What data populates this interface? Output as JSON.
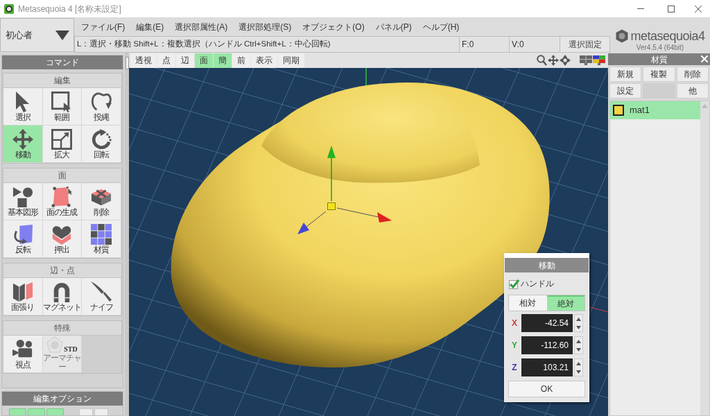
{
  "window": {
    "title": "Metasequoia 4 [名称未設定]"
  },
  "mode_dropdown": {
    "value": "初心者"
  },
  "menu": [
    "ファイル(F)",
    "編集(E)",
    "選択部属性(A)",
    "選択部処理(S)",
    "オブジェクト(O)",
    "パネル(P)",
    "ヘルプ(H)"
  ],
  "status_bar": {
    "hint": "L：選択・移動 Shift+L：複数選択（ハンドル Ctrl+Shift+L：中心回転)",
    "faces": "F:0",
    "vertices": "V:0",
    "lock_button": "選択固定"
  },
  "logo": {
    "wordmark": "metasequoia4",
    "version": "Ver4.5.4 (64bit)"
  },
  "command_panel": {
    "title": "コマンド",
    "sections": [
      {
        "title": "編集",
        "tools": [
          {
            "label": "選択",
            "kind": "select",
            "selected": false,
            "disabled": false
          },
          {
            "label": "範囲",
            "kind": "range",
            "selected": false,
            "disabled": false
          },
          {
            "label": "投縄",
            "kind": "lasso",
            "selected": false,
            "disabled": false
          },
          {
            "label": "移動",
            "kind": "move",
            "selected": true,
            "disabled": false
          },
          {
            "label": "拡大",
            "kind": "scale",
            "selected": false,
            "disabled": false
          },
          {
            "label": "回転",
            "kind": "rotate",
            "selected": false,
            "disabled": false
          }
        ]
      },
      {
        "title": "面",
        "tools": [
          {
            "label": "基本図形",
            "kind": "primitive",
            "selected": false,
            "disabled": false
          },
          {
            "label": "面の生成",
            "kind": "face",
            "selected": false,
            "disabled": false
          },
          {
            "label": "削除",
            "kind": "delete",
            "selected": false,
            "disabled": false
          },
          {
            "label": "反転",
            "kind": "flip",
            "selected": false,
            "disabled": false
          },
          {
            "label": "押出",
            "kind": "extrude",
            "selected": false,
            "disabled": false
          },
          {
            "label": "材質",
            "kind": "material",
            "selected": false,
            "disabled": false
          }
        ]
      },
      {
        "title": "辺・点",
        "tools": [
          {
            "label": "面張り",
            "kind": "bridge",
            "selected": false,
            "disabled": false
          },
          {
            "label": "マグネット",
            "kind": "magnet",
            "selected": false,
            "disabled": false
          },
          {
            "label": "ナイフ",
            "kind": "knife",
            "selected": false,
            "disabled": false
          }
        ]
      },
      {
        "title": "特殊",
        "tools": [
          {
            "label": "視点",
            "kind": "viewpoint",
            "selected": false,
            "disabled": false
          },
          {
            "label": "アーマチャー",
            "kind": "armature",
            "badge": "STD",
            "selected": false,
            "disabled": true
          }
        ]
      }
    ]
  },
  "edit_options": {
    "title": "編集オプション",
    "buttons": [
      {
        "selected": true
      },
      {
        "selected": true
      },
      {
        "selected": true
      },
      {
        "selected": false
      },
      {
        "selected": false
      }
    ]
  },
  "viewport_toolbar": [
    {
      "label": "透視",
      "selected": false
    },
    {
      "label": "点",
      "selected": false
    },
    {
      "label": "辺",
      "selected": false
    },
    {
      "label": "面",
      "selected": true
    },
    {
      "label": "簡",
      "selected": true
    },
    {
      "label": "前",
      "selected": false
    },
    {
      "label": "表示",
      "selected": false
    },
    {
      "label": "同期",
      "selected": false
    }
  ],
  "move_dialog": {
    "title": "移動",
    "handle": {
      "label": "ハンドル",
      "checked": true
    },
    "modes": [
      {
        "label": "相対",
        "selected": false
      },
      {
        "label": "絶対",
        "selected": true
      }
    ],
    "fields": [
      {
        "axis": "X",
        "value": "-42.54",
        "color": "#d83a3a"
      },
      {
        "axis": "Y",
        "value": "-112.60",
        "color": "#3aa83a"
      },
      {
        "axis": "Z",
        "value": "103.21",
        "color": "#3a3aa8"
      }
    ],
    "ok": "OK"
  },
  "material_panel": {
    "title": "材質",
    "buttons": [
      "新規",
      "複製",
      "削除",
      "設定",
      "他"
    ],
    "materials": [
      {
        "name": "mat1",
        "color": "#f5d442",
        "selected": true
      }
    ]
  }
}
